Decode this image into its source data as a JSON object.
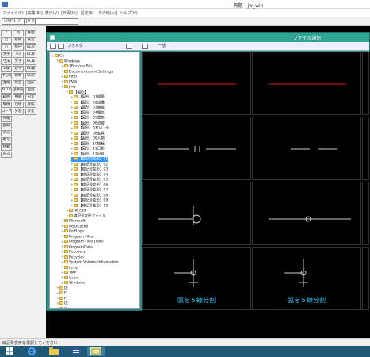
{
  "window": {
    "title": "無題 - jw_win"
  },
  "menu": [
    "ファイル(F)",
    "[編集(E)]",
    "表示(V)",
    "[作図(D)]",
    "設定(S)",
    "[その他(A)]",
    "ヘルプ(H)"
  ],
  "layer_bar": {
    "button": "ﾚｲﾔｸﾞﾙｰﾌﾟ",
    "layer_label": "[0-0]"
  },
  "toolbar_left": [
    "点",
    "接線",
    "接円",
    "ﾊｯﾁ",
    "文字",
    "建平",
    "建断",
    "建立",
    "多角形",
    "曲線",
    "包絡",
    "分割",
    "整理",
    "属変",
    "BL化",
    "BL解",
    "BL属",
    "BL編",
    "BL終",
    "図形",
    "図登",
    "記変",
    "座標",
    "外変"
  ],
  "toolbar_right": [
    "/",
    "□",
    "○",
    "文字",
    "寸法",
    "2線",
    "中心線",
    "連線",
    "AUTO",
    "範囲",
    "複線",
    "コーナー",
    "伸縮",
    "面取",
    "消去",
    "複写",
    "移動",
    "戻る"
  ],
  "dialog": {
    "title": "ファイル選択",
    "toolbar": [
      "フォルダ",
      "一括"
    ],
    "selected_index": 20
  },
  "tree": [
    {
      "label": "C:\\",
      "depth": 0
    },
    {
      "label": "Windows",
      "depth": 1
    },
    {
      "label": "$Recycle.Bin",
      "depth": 2
    },
    {
      "label": "Documents and Settings",
      "depth": 2
    },
    {
      "label": "Intel",
      "depth": 2
    },
    {
      "label": "JWW",
      "depth": 2
    },
    {
      "label": "jww",
      "depth": 2
    },
    {
      "label": "【図形】",
      "depth": 3
    },
    {
      "label": "【図形】01建築",
      "depth": 4
    },
    {
      "label": "【図形】02設備",
      "depth": 4
    },
    {
      "label": "【図形】03機械",
      "depth": 4
    },
    {
      "label": "【図形】04電気",
      "depth": 4
    },
    {
      "label": "【図形】05電気",
      "depth": 4
    },
    {
      "label": "【図形】06点線",
      "depth": 4
    },
    {
      "label": "【図形】07ｴﾚﾍﾞｰﾀｰ",
      "depth": 4
    },
    {
      "label": "【図形】08家具",
      "depth": 4
    },
    {
      "label": "【図形】09人物",
      "depth": 4
    },
    {
      "label": "【図形】10植栽",
      "depth": 4
    },
    {
      "label": "【図形】11日影",
      "depth": 4
    },
    {
      "label": "【図形】12記号",
      "depth": 4
    },
    {
      "label": "【線記号変形】01",
      "depth": 4
    },
    {
      "label": "【線記号変形】02",
      "depth": 4
    },
    {
      "label": "【線記号変形】03",
      "depth": 4
    },
    {
      "label": "【線記号変形】04",
      "depth": 4
    },
    {
      "label": "【線記号変形】05",
      "depth": 4
    },
    {
      "label": "【線記号変形】06",
      "depth": 4
    },
    {
      "label": "【線記号変形】07",
      "depth": 4
    },
    {
      "label": "【線記号変形】08",
      "depth": 4
    },
    {
      "label": "【線記号変形】09",
      "depth": 4
    },
    {
      "label": "【線記号変形】10",
      "depth": 4
    },
    {
      "label": "Jw_cad",
      "depth": 3
    },
    {
      "label": "線記号変形ファイル",
      "depth": 3
    },
    {
      "label": "Microsoft",
      "depth": 2
    },
    {
      "label": "MSOCache",
      "depth": 2
    },
    {
      "label": "PerfLogs",
      "depth": 2
    },
    {
      "label": "Program Files",
      "depth": 2
    },
    {
      "label": "Program Files (x86)",
      "depth": 2
    },
    {
      "label": "ProgramData",
      "depth": 2
    },
    {
      "label": "Recovery",
      "depth": 2
    },
    {
      "label": "Recycler",
      "depth": 2
    },
    {
      "label": "System Volume Information",
      "depth": 2
    },
    {
      "label": "temp",
      "depth": 2
    },
    {
      "label": "TMP",
      "depth": 2
    },
    {
      "label": "Users",
      "depth": 2
    },
    {
      "label": "Windows",
      "depth": 2
    },
    {
      "label": "D:",
      "depth": 1
    },
    {
      "label": "E:",
      "depth": 1
    },
    {
      "label": "F:",
      "depth": 1
    },
    {
      "label": "G:",
      "depth": 1
    },
    {
      "label": "H:",
      "depth": 1
    }
  ],
  "thumbnails": [
    {
      "label": "",
      "caption": "",
      "kind": "red"
    },
    {
      "label": "",
      "caption": "",
      "kind": "red"
    },
    {
      "label": "",
      "caption": "",
      "kind": "line-gap"
    },
    {
      "label": "",
      "caption": "",
      "kind": "line-short"
    },
    {
      "label": "",
      "caption": "",
      "kind": "circle"
    },
    {
      "label": "",
      "caption": "",
      "kind": "circle-right"
    },
    {
      "label": "",
      "caption": "弧を５線分割",
      "kind": "arc"
    },
    {
      "label": "",
      "caption": "弧を５線分割",
      "kind": "arc"
    }
  ],
  "statusbar": {
    "text": "線記号変形を選択してください"
  }
}
